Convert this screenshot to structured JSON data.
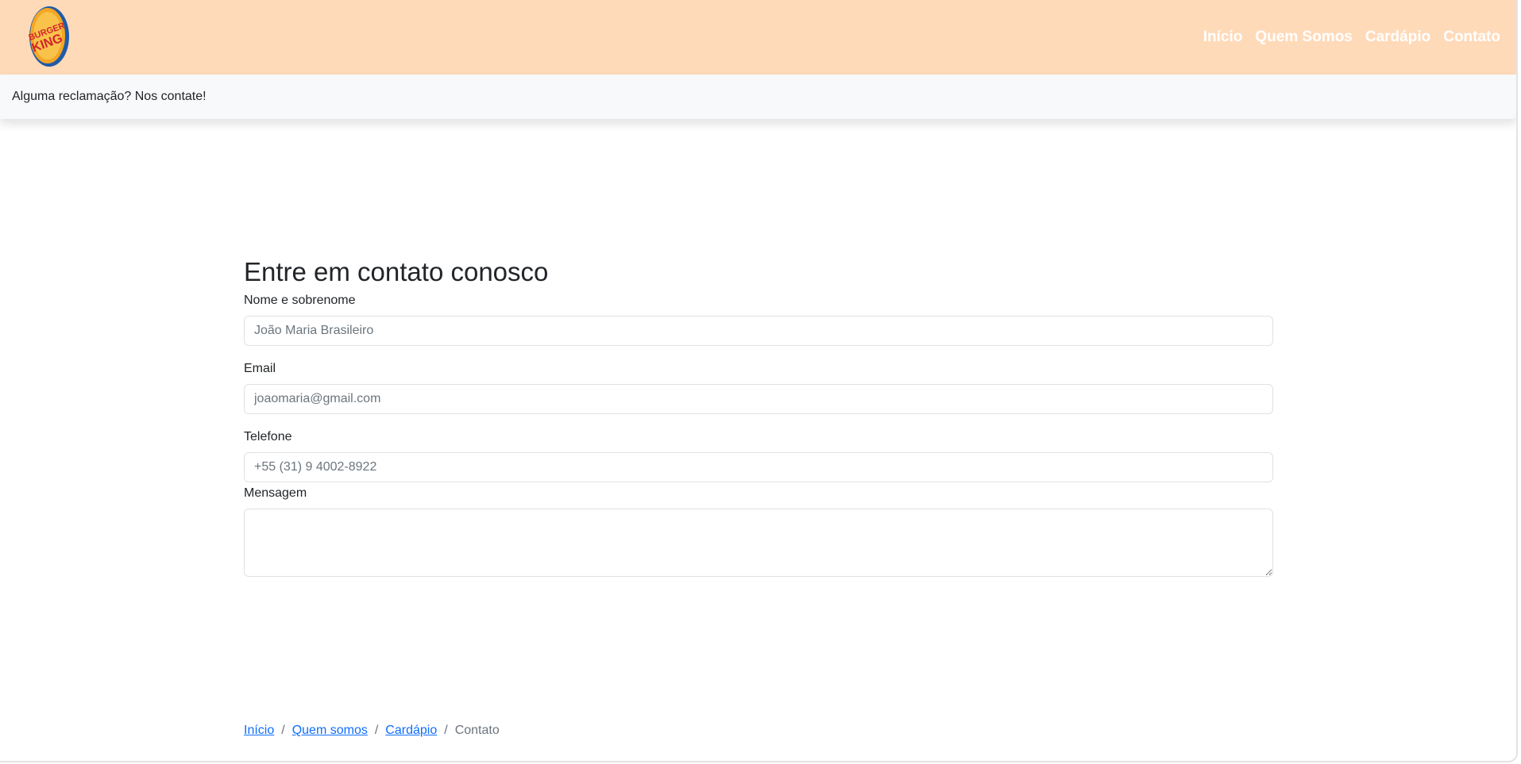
{
  "brand": {
    "logo_line1": "BURGER",
    "logo_line2": "KING"
  },
  "nav": {
    "items": [
      "Início",
      "Quem Somos",
      "Cardápio",
      "Contato"
    ]
  },
  "subbar": {
    "text": "Alguma reclamação? Nos contate!"
  },
  "form": {
    "title": "Entre em contato conosco",
    "name_label": "Nome e sobrenome",
    "name_placeholder": "João Maria Brasileiro",
    "email_label": "Email",
    "email_placeholder": "joaomaria@gmail.com",
    "phone_label": "Telefone",
    "phone_placeholder": "+55 (31) 9 4002-8922",
    "message_label": "Mensagem",
    "message_value": ""
  },
  "breadcrumb": {
    "items": [
      "Início",
      "Quem somos",
      "Cardápio"
    ],
    "separator": "/",
    "current": "Contato"
  },
  "colors": {
    "header_bg": "#ffdab9",
    "nav_text": "#ffffff",
    "subbar_bg": "#f8f9fa",
    "link": "#0d6efd",
    "logo_red": "#d2232a",
    "logo_yellow": "#f5a623",
    "logo_blue": "#1f5ba8"
  }
}
